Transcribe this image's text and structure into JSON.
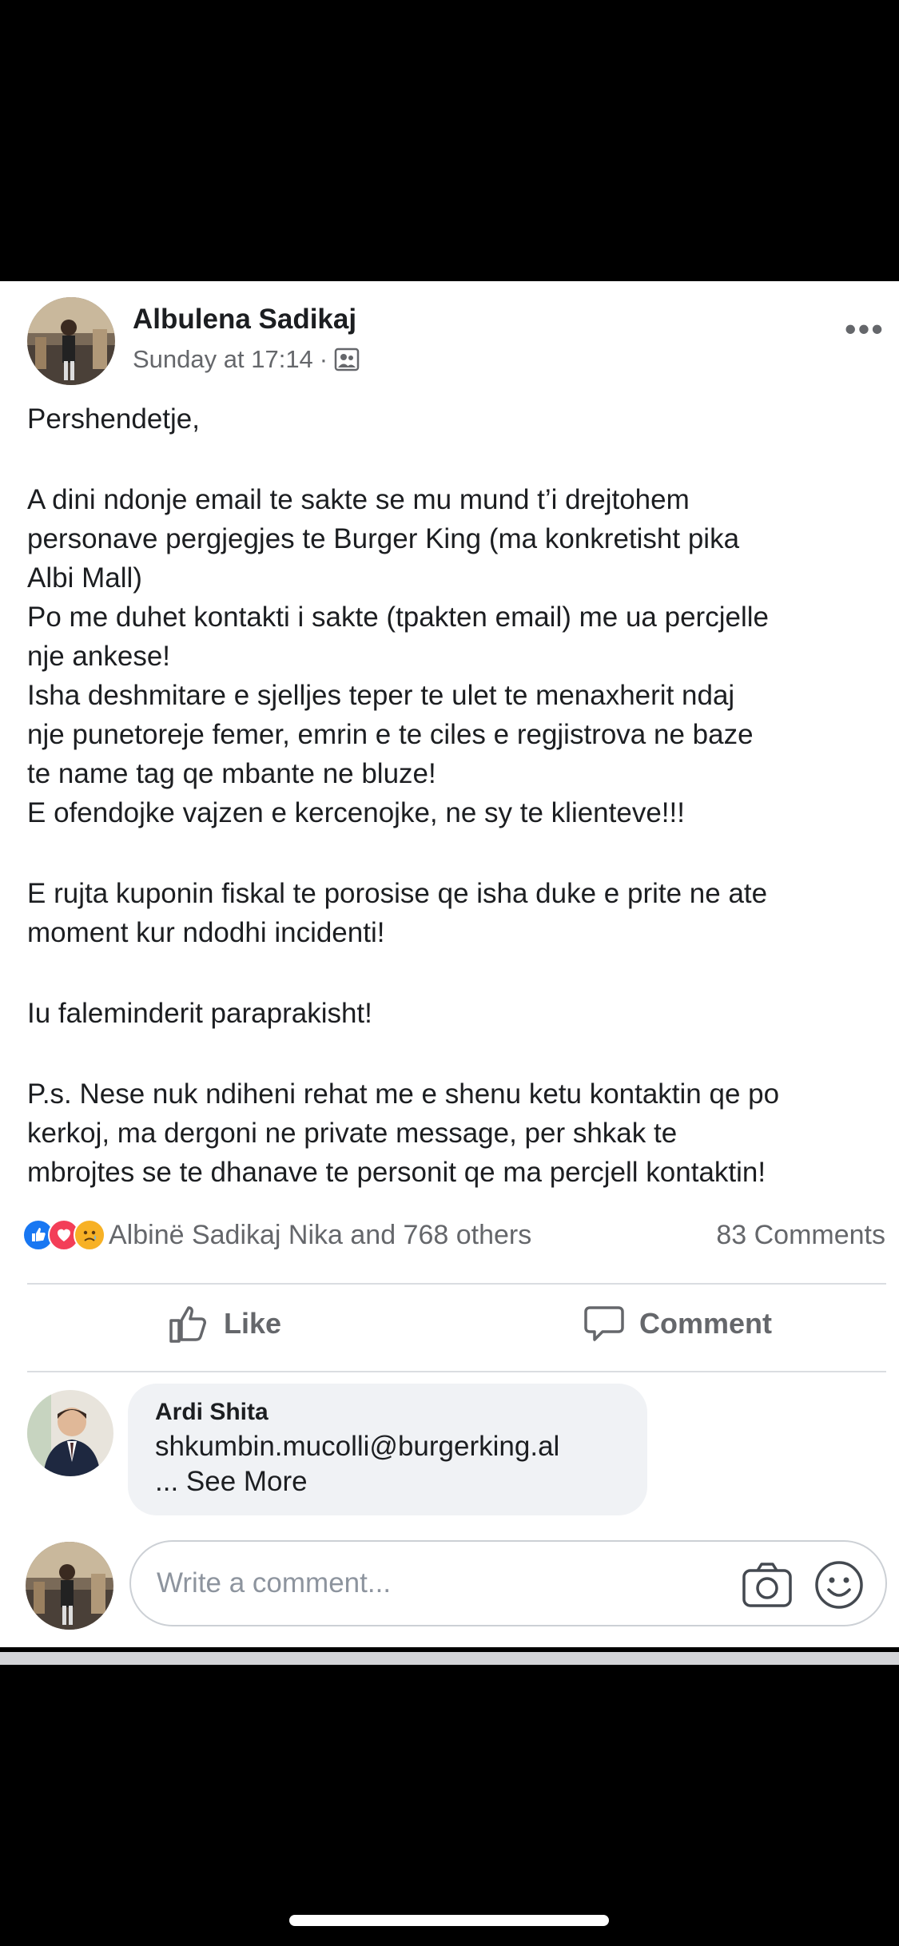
{
  "post": {
    "author": "Albulena Sadikaj",
    "timestamp": "Sunday at 17:14",
    "meta_separator": "·",
    "audience_icon": "friends-icon",
    "more_label": "•••",
    "body": [
      "Pershendetje,",
      "",
      "A dini ndonje email te sakte se mu mund t’i drejtohem",
      "personave pergjegjes te Burger King (ma konkretisht pika",
      "Albi Mall)",
      "Po me duhet kontakti i sakte (tpakten email) me ua percjelle",
      "nje ankese!",
      "Isha deshmitare e sjelljes teper te ulet te menaxherit ndaj",
      "nje punetoreje femer, emrin e te ciles e regjistrova ne baze",
      "te name tag qe mbante ne bluze!",
      "E ofendojke vajzen e kercenojke, ne sy te klienteve!!!",
      "",
      "E rujta kuponin fiskal te porosise qe isha duke e prite ne ate",
      "moment kur ndodhi incidenti!",
      "",
      "Iu faleminderit paraprakisht!",
      "",
      "P.s. Nese nuk ndiheni rehat me e shenu ketu kontaktin qe po",
      "kerkoj, ma dergoni ne private message, per shkak te",
      "mbrojtes se te dhanave te personit qe ma percjell kontaktin!"
    ]
  },
  "reactions": {
    "icons": [
      "like-icon",
      "love-icon",
      "sad-icon"
    ],
    "colors": {
      "like": "#1877f2",
      "love": "#f33e58",
      "sad": "#f7b125"
    },
    "reactors_text": "Albinë Sadikaj Nika and 768 others",
    "comments_count": "83 Comments"
  },
  "actions": {
    "like_label": "Like",
    "comment_label": "Comment"
  },
  "comment": {
    "author": "Ardi Shita",
    "text": "shkumbin.mucolli@burgerking.al",
    "see_more": "... See More"
  },
  "composer": {
    "placeholder": "Write a comment..."
  }
}
